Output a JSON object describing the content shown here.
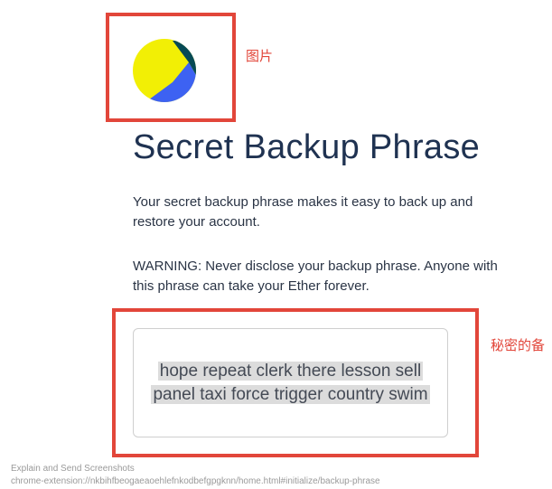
{
  "annotations": {
    "image_label": "图片",
    "phrase_label": "秘密的备"
  },
  "header": {
    "avatar_icon": "identicon-avatar-icon",
    "avatar_colors": [
      "#f2ef05",
      "#3d62f2",
      "#064a55"
    ]
  },
  "main": {
    "title": "Secret Backup Phrase",
    "description": "Your secret backup phrase makes it easy to back up and restore your account.",
    "warning": "WARNING: Never disclose your backup phrase. Anyone with this phrase can take your Ether forever.",
    "phrase": "hope repeat clerk there lesson sell panel taxi force trigger country swim"
  },
  "footer": {
    "caption": "Explain and Send Screenshots",
    "url": "chrome-extension://nkbihfbeogaeaoehlefnkodbefgpgknn/home.html#initialize/backup-phrase"
  },
  "colors": {
    "annotation_red": "#e2463a",
    "title_navy": "#1f3251",
    "phrase_highlight": "#dcdcdc"
  }
}
